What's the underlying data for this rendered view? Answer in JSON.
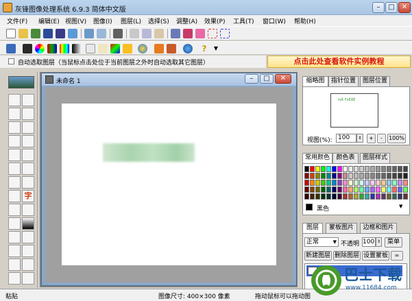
{
  "window": {
    "title": "灰锋图像处理系统 6.9.3 简体中文版"
  },
  "menu": [
    "文件(F)",
    "编辑(E)",
    "视图(V)",
    "图像(I)",
    "图层(L)",
    "选择(S)",
    "调整(A)",
    "效果(P)",
    "工具(T)",
    "窗口(W)",
    "帮助(H)"
  ],
  "options_bar": {
    "auto_select_label": "自动选取图层（当鼠标点击处位于当前图层之外时自动选取其它图层）"
  },
  "banner": {
    "text": "点击此处查看软件实例教程"
  },
  "document": {
    "title": "未命名 1"
  },
  "nav_panel": {
    "tabs": [
      "缩略图",
      "指针位置",
      "图层位置"
    ],
    "zoom_label": "视图(%):",
    "zoom_value": "100",
    "zoom_plus": "+",
    "zoom_minus": "-",
    "zoom_100": "100%",
    "thumb_text": "I¤Ä F¤ÈÄÈ"
  },
  "color_panel": {
    "tabs": [
      "常用颜色",
      "颜色表",
      "图层样式"
    ],
    "selected_color_name": "黑色",
    "selected_color": "#000000"
  },
  "layers_panel": {
    "tabs": [
      "图层",
      "蒙板图片",
      "边框和图片"
    ],
    "blend_mode": "正常",
    "opacity_label": "不透明",
    "opacity_value": "100",
    "menu_button": "菜单",
    "new_layer": "新建图层",
    "delete_layer": "删除图层",
    "set_mask": "设置蒙板"
  },
  "statusbar": {
    "left": "粘贴",
    "image_size": "图像尺寸: 400×300 像素",
    "hint": "拖动鼠标可以拖动图"
  },
  "watermark": {
    "brand": "巴士下载",
    "url": "www.11684.com"
  },
  "colors": {
    "accent_banner_text": "#d81a0a",
    "titlebar": "#bcd5ee"
  }
}
